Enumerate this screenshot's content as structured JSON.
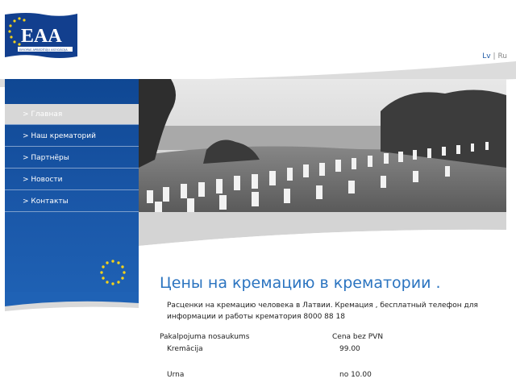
{
  "logo": {
    "text": "EAA",
    "subtext": "EIROPAS APBEDĪTĀJU ASOCIĀCIJA"
  },
  "languages": {
    "lv": "Lv",
    "separator": "|",
    "ru": "Ru"
  },
  "nav": [
    {
      "label": "> Главная",
      "active": true
    },
    {
      "label": "> Наш крематорий",
      "active": false
    },
    {
      "label": "> Партнёры",
      "active": false
    },
    {
      "label": "> Новости",
      "active": false
    },
    {
      "label": "> Контакты",
      "active": false
    }
  ],
  "main": {
    "title": "Цены на кремацию в крематории .",
    "intro": "Расценки на кремацию человека в Латвии. Кремация , бесплатный телефон для информации и работы крематория 8000 88 18",
    "table": {
      "headers": [
        "Pakalpojuma nosaukums",
        "Cena bez PVN"
      ],
      "rows": [
        {
          "name": "Kremācija",
          "price": "99.00"
        },
        {
          "name": "Urna",
          "price": "no 10.00"
        }
      ]
    }
  },
  "colors": {
    "brand_blue": "#1a57a8",
    "title_blue": "#2b74c0",
    "active_nav": "#d7d7d7"
  }
}
